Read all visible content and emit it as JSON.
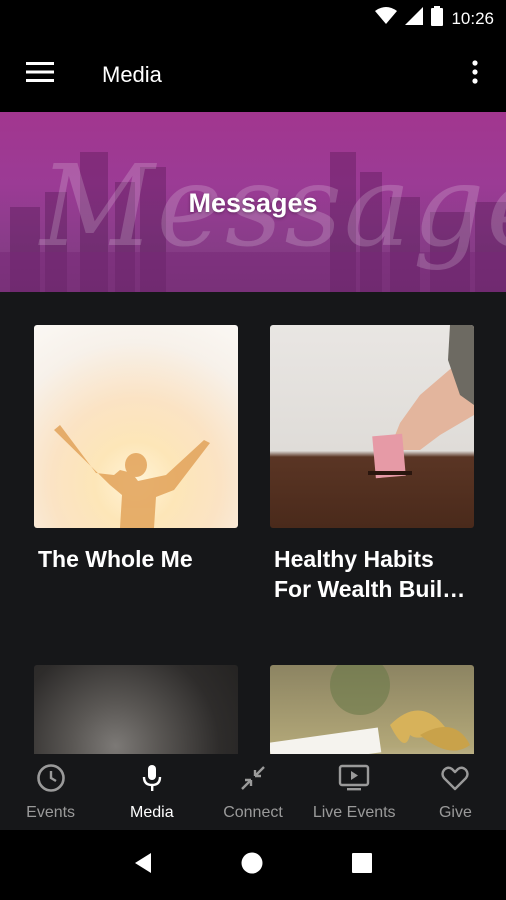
{
  "status_bar": {
    "time": "10:26"
  },
  "app_bar": {
    "title": "Media"
  },
  "hero": {
    "title": "Messages",
    "script_text": "Messages"
  },
  "cards": [
    {
      "title": "The Whole Me"
    },
    {
      "title": "Healthy Habits For Wealth Buil…"
    },
    {
      "title": ""
    },
    {
      "title": ""
    }
  ],
  "bottom_nav": {
    "items": [
      {
        "label": "Events",
        "icon": "clock-icon",
        "active": false
      },
      {
        "label": "Media",
        "icon": "microphone-icon",
        "active": true
      },
      {
        "label": "Connect",
        "icon": "connect-arrows-icon",
        "active": false
      },
      {
        "label": "Live Events",
        "icon": "tv-play-icon",
        "active": false
      },
      {
        "label": "Give",
        "icon": "heart-icon",
        "active": false
      }
    ]
  },
  "colors": {
    "hero_purple": "#9b3b95",
    "background": "#161719",
    "inactive": "#9a9a9a"
  }
}
